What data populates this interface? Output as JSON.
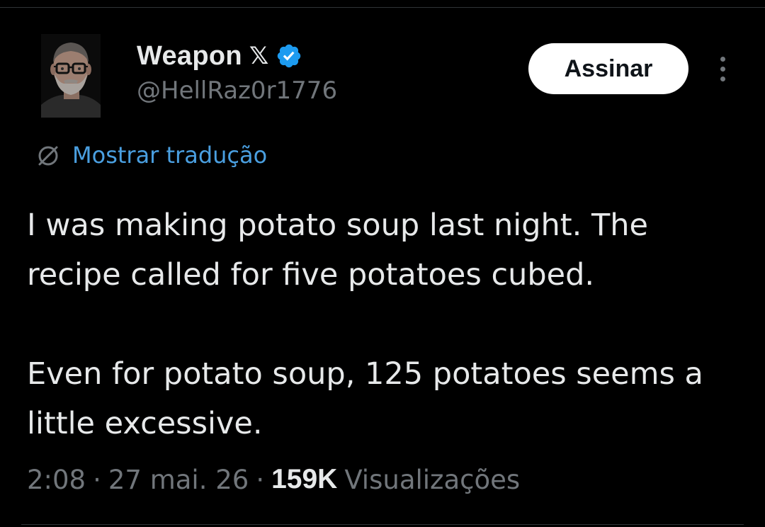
{
  "author": {
    "display_name": "Weapon",
    "affiliate_badge": "𝕏",
    "handle": "@HellRaz0r1776",
    "verified": true,
    "verified_color": "#1d9bf0"
  },
  "header": {
    "subscribe_label": "Assinar",
    "more_icon": "more-vertical-icon"
  },
  "translate": {
    "icon": "globe-icon",
    "label": "Mostrar tradução",
    "color": "#4a9fe0"
  },
  "tweet": {
    "paragraphs": [
      "I was making potato soup last night. The recipe called for five potatoes cubed.",
      "Even for potato soup, 125 potatoes seems a little excessive."
    ]
  },
  "meta": {
    "time": "2:08",
    "date": "27 mai. 26",
    "views_count": "159K",
    "views_label": "Visualizações"
  },
  "colors": {
    "background": "#000000",
    "text_primary": "#e7e9ea",
    "text_secondary": "#71767b",
    "button_bg": "#ffffff"
  }
}
